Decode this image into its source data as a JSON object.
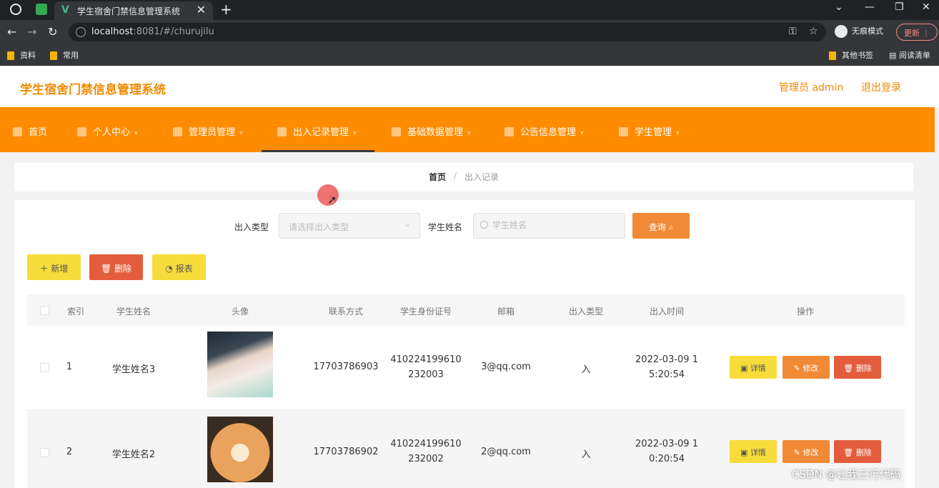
{
  "browser": {
    "tab_title": "学生宿舍门禁信息管理系统",
    "tab_close": "✕",
    "new_tab": "+",
    "url_host": "localhost",
    "url_path": ":8081/#/churujilu",
    "incognito_label": "无痕模式",
    "update_label": "更新",
    "bookmarks": [
      "资料",
      "常用"
    ],
    "other_bookmarks": "其他书签",
    "reading_list": "阅读清单"
  },
  "app": {
    "title": "学生宿舍门禁信息管理系统",
    "admin_label": "管理员 admin",
    "logout_label": "退出登录"
  },
  "nav": {
    "items": [
      "首页",
      "个人中心",
      "管理员管理",
      "出入记录管理",
      "基础数据管理",
      "公告信息管理",
      "学生管理"
    ]
  },
  "breadcrumb": {
    "home": "首页",
    "sep": "/",
    "current": "出入记录"
  },
  "filters": {
    "type_label": "出入类型",
    "type_placeholder": "请选择出入类型",
    "name_label": "学生姓名",
    "name_placeholder": "学生姓名",
    "query_label": "查询"
  },
  "toolbar": {
    "add_label": "＋ 新增",
    "delete_label": "删除",
    "report_label": "报表"
  },
  "table": {
    "headers": [
      "索引",
      "学生姓名",
      "头像",
      "联系方式",
      "学生身份证号",
      "邮箱",
      "出入类型",
      "出入时间",
      "操作"
    ],
    "rows": [
      {
        "index": "1",
        "name": "学生姓名3",
        "phone": "17703786903",
        "id_line1": "410224199610",
        "id_line2": "232003",
        "email": "3@qq.com",
        "type": "入",
        "time_line1": "2022-03-09 1",
        "time_line2": "5:20:54"
      },
      {
        "index": "2",
        "name": "学生姓名2",
        "phone": "17703786902",
        "id_line1": "410224199610",
        "id_line2": "232002",
        "email": "2@qq.com",
        "type": "入",
        "time_line1": "2022-03-09 1",
        "time_line2": "0:20:54"
      }
    ],
    "actions": {
      "detail": "详情",
      "edit": "修改",
      "delete": "删除"
    }
  },
  "watermark": "CSDN @让我三行代码",
  "colors": {
    "accent": "#ff8c00",
    "brand_text": "#f08a00",
    "danger": "#e35d3d",
    "warning": "#f7dc3c"
  }
}
